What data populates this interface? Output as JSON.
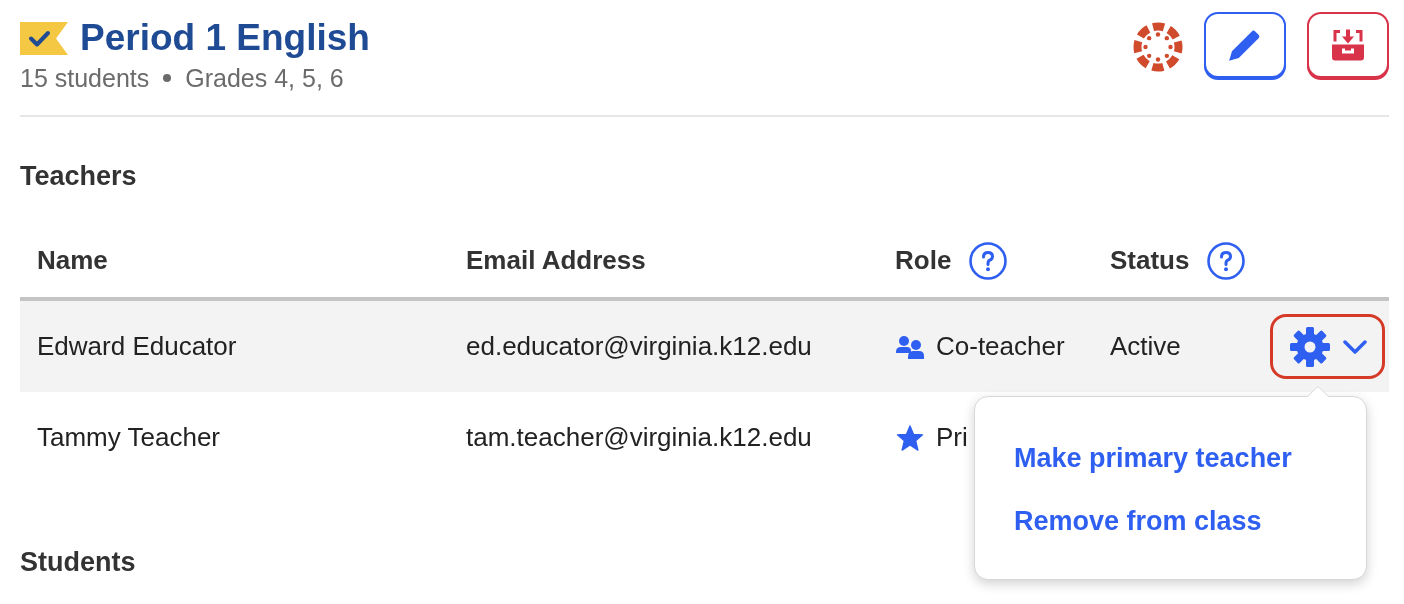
{
  "class": {
    "title": "Period 1 English",
    "student_count": "15 students",
    "grades": "Grades 4, 5, 6"
  },
  "teachers": {
    "heading": "Teachers",
    "columns": [
      {
        "label": "Name",
        "help": false
      },
      {
        "label": "Email Address",
        "help": false
      },
      {
        "label": "Role",
        "help": true
      },
      {
        "label": "Status",
        "help": true
      }
    ],
    "rows": [
      {
        "name": "Edward Educator",
        "email": "ed.educator@virginia.k12.edu",
        "role": {
          "kind": "co-teacher",
          "label": "Co-teacher"
        },
        "status": "Active",
        "selected": true
      },
      {
        "name": "Tammy Teacher",
        "email": "tam.teacher@virginia.k12.edu",
        "role": {
          "kind": "primary",
          "label": "Pri"
        },
        "selected": false
      }
    ]
  },
  "row_menu": {
    "items": [
      "Make primary teacher",
      "Remove from class"
    ]
  },
  "students": {
    "heading": "Students"
  }
}
